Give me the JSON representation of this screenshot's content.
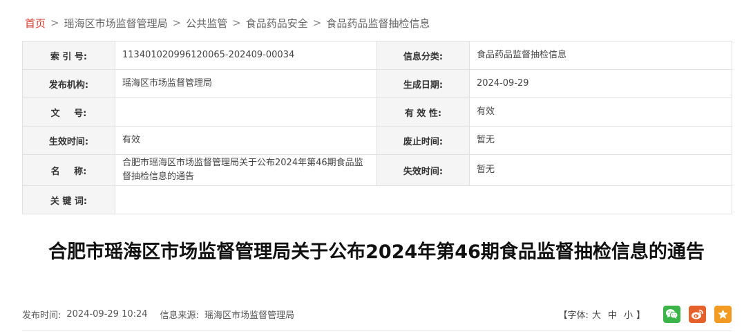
{
  "breadcrumb": {
    "home": "首页",
    "separator": ">",
    "items": [
      "瑶海区市场监督管理局",
      "公共监管",
      "食品药品安全",
      "食品药品监督抽检信息"
    ]
  },
  "meta": {
    "index_label": "索 引 号:",
    "index_value": "113401020996120065-202409-00034",
    "category_label": "信息分类:",
    "category_value": "食品药品监督抽检信息",
    "publisher_label": "发布机构:",
    "publisher_value": "瑶海区市场监督管理局",
    "created_label": "生成日期:",
    "created_value": "2024-09-29",
    "docno_label": "文 号:",
    "docno_value": "",
    "validity_label": "有 效 性:",
    "validity_value": "有效",
    "effective_label": "生效时间:",
    "effective_value": "有效",
    "repeal_label": "废止时间:",
    "repeal_value": "暂无",
    "name_label": "名 称:",
    "name_value": "合肥市瑶海区市场监督管理局关于公布2024年第46期食品监督抽检信息的通告",
    "expire_label": "失效时间:",
    "expire_value": "暂无",
    "keywords_label": "关 键 词:",
    "keywords_value": ""
  },
  "article": {
    "title": "合肥市瑶海区市场监督管理局关于公布2024年第46期食品监督抽检信息的通告"
  },
  "infobar": {
    "publish_time_label": "发布时间:",
    "publish_time_value": "2024-09-29 10:24",
    "source_label": "信息来源:",
    "source_value": "瑶海区市场监督管理局",
    "font_prefix": "【字体:",
    "font_large": "大",
    "font_medium": "中",
    "font_small": "小",
    "font_suffix": "】"
  },
  "share": {
    "icons": [
      "wechat-icon",
      "weibo-icon",
      "star-icon"
    ],
    "colors": {
      "wechat": "#3bb54a",
      "weibo": "#e5612c",
      "favorite": "#f29a21"
    }
  },
  "colors": {
    "home_link": "#d63a2e",
    "label_bg": "#f5f5f5",
    "border": "#e1e1e1"
  }
}
